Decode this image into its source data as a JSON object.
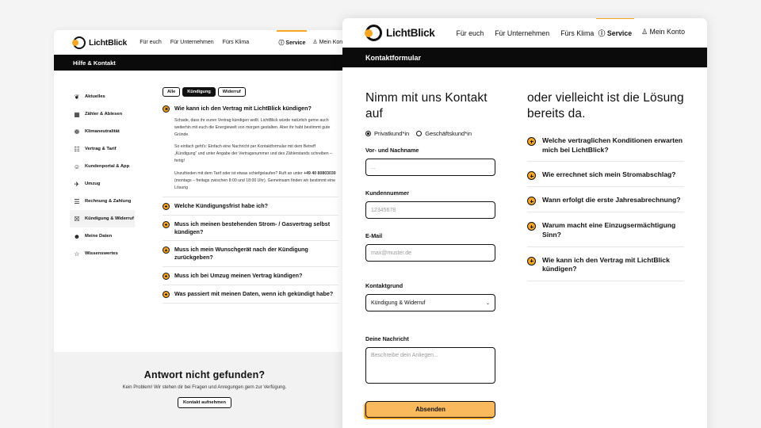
{
  "left": {
    "logo": "LichtBlick",
    "nav_links": [
      "Für euch",
      "Für Unternehmen",
      "Fürs Klima"
    ],
    "service": "Service",
    "account": "Mein Konto",
    "bar_title": "Hilfe & Kontakt",
    "sidebar": [
      {
        "icon": "flame-icon",
        "glyph": "❦",
        "label": "Aktuelles"
      },
      {
        "icon": "meter-icon",
        "glyph": "▦",
        "label": "Zähler & Ablesen"
      },
      {
        "icon": "globe-icon",
        "glyph": "❁",
        "label": "Klimaneutralität"
      },
      {
        "icon": "contract-icon",
        "glyph": "☷",
        "label": "Vertrag & Tarif"
      },
      {
        "icon": "people-icon",
        "glyph": "☺",
        "label": "Kundenportal & App"
      },
      {
        "icon": "rocket-icon",
        "glyph": "✈",
        "label": "Umzug"
      },
      {
        "icon": "invoice-icon",
        "glyph": "☰",
        "label": "Rechnung & Zahlung"
      },
      {
        "icon": "cancel-doc-icon",
        "glyph": "☒",
        "label": "Kündigung & Widerruf"
      },
      {
        "icon": "user-data-icon",
        "glyph": "☻",
        "label": "Meine Daten"
      },
      {
        "icon": "star-icon",
        "glyph": "☆",
        "label": "Wissenswertes"
      }
    ],
    "active_index": 7,
    "pills": [
      "Alle",
      "Kündigung",
      "Widerruf"
    ],
    "active_pill": 1,
    "open_faq": {
      "question": "Wie kann ich den Vertrag mit LichtBlick kündigen?",
      "p1": "Schade, dass ihr euren Vertrag kündigen wollt. LichtBlick würde natürlich gerne auch weiterhin mit euch die Energiewelt von morgen gestalten. Aber ihr habt bestimmt gute Gründe.",
      "p2": "So einfach geht's: Einfach eine Nachricht per Kontaktformular mit dem Betreff „Kündigung“ und unter Angabe der Vertragsnummer und des Zählerstands schreiben – fertig!",
      "p3a": "Unzufrieden mit dem Tarif oder ist etwas schiefgelaufen? Ruft an unter ",
      "phone": "+49 40 80803030",
      "p3b": " (montags – freitags zwischen 8:00 und 18:00 Uhr). Gemeinsam finden wir bestimmt eine Lösung"
    },
    "faqs": [
      "Welche Kündigungsfrist habe ich?",
      "Muss ich meinen bestehenden Strom- / Gasvertrag selbst kündigen?",
      "Muss ich mein Wunschgerät nach der Kündigung zurückgeben?",
      "Muss ich bei Umzug meinen Vertrag kündigen?",
      "Was passiert mit meinen Daten, wenn ich gekündigt habe?"
    ],
    "footer": {
      "title": "Antwort nicht gefunden?",
      "text": "Kein Problem! Wir stehen dir bei Fragen und Anregungen gern zur Verfügung.",
      "button": "Kontakt aufnehmen"
    }
  },
  "right": {
    "logo": "LichtBlick",
    "nav_links": [
      "Für euch",
      "Für Unternehmen",
      "Fürs Klima"
    ],
    "service": "Service",
    "account": "Mein Konto",
    "bar_title": "Kontaktformular",
    "form": {
      "heading": "Nimm mit uns Kontakt auf",
      "radio_private": "Privatkund*in",
      "radio_business": "Geschäftskund*in",
      "name_label": "Vor- und Nachname",
      "name_placeholder": "...",
      "customer_label": "Kundennummer",
      "customer_placeholder": "12345678",
      "email_label": "E-Mail",
      "email_placeholder": "max@muster.de",
      "topic_label": "Kontaktgrund",
      "topic_value": "Kündigung & Widerruf",
      "message_label": "Deine Nachricht",
      "message_placeholder": "Beschreibe dein Anliegen...",
      "submit": "Absenden"
    },
    "faq_heading": "oder vielleicht ist die Lösung bereits da.",
    "faqs": [
      "Welche vertraglichen Konditionen erwarten mich bei LichtBlick?",
      "Wie errechnet sich mein Stromabschlag?",
      "Wann erfolgt die erste Jahresabrechnung?",
      "Warum macht eine Einzugsermächtigung Sinn?",
      "Wie kann ich den Vertrag mit LichtBlick kündigen?"
    ]
  },
  "colors": {
    "accent": "#f5a623",
    "button": "#f9b95c",
    "dark": "#0b0b0b"
  }
}
